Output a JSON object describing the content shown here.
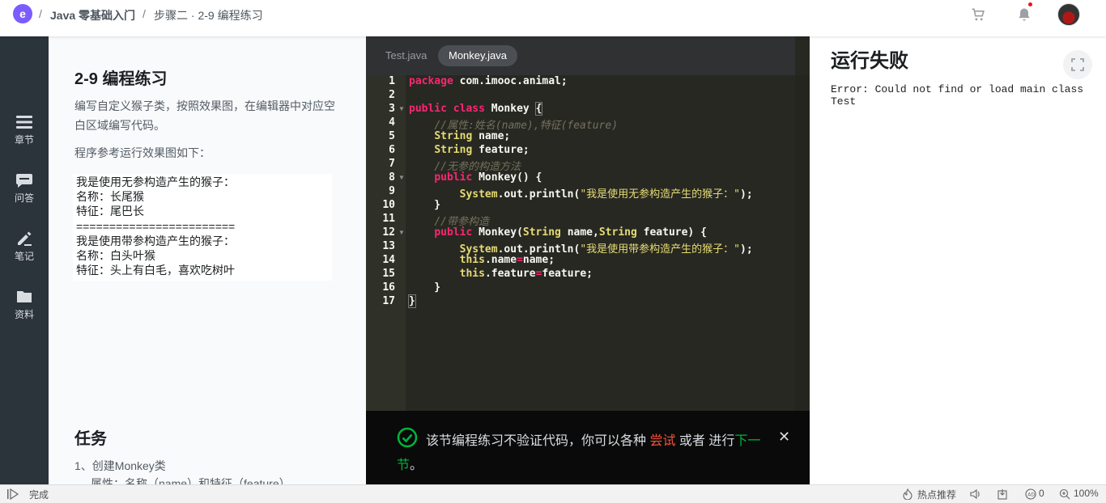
{
  "topbar": {
    "logo_glyph": "e",
    "sep1": "/",
    "course": "Java 零基础入门",
    "sep2": "/",
    "lesson": "步骤二 · 2-9 编程练习"
  },
  "leftnav": {
    "items": [
      {
        "label": "章节",
        "icon": "list-icon"
      },
      {
        "label": "问答",
        "icon": "chat-icon"
      },
      {
        "label": "笔记",
        "icon": "pencil-icon"
      },
      {
        "label": "资料",
        "icon": "folder-icon"
      }
    ]
  },
  "description": {
    "title": "2-9 编程练习",
    "intro": "编写自定义猴子类，按照效果图，在编辑器中对应空白区域编写代码。",
    "sample_caption": "程序参考运行效果图如下：",
    "sample_lines": [
      "我是使用无参构造产生的猴子：",
      "名称：长尾猴",
      "特征：尾巴长",
      "========================",
      "我是使用带参构造产生的猴子：",
      "名称：白头叶猴",
      "特征：头上有白毛，喜欢吃树叶"
    ],
    "task_title": "任务",
    "task_1": "1、创建Monkey类",
    "task_2": "属性：名称（name）和特征（feature）"
  },
  "editor": {
    "tabs": [
      "Test.java",
      "Monkey.java"
    ],
    "active_tab": "Monkey.java",
    "line_numbers": [
      "1",
      "2",
      "3",
      "4",
      "5",
      "6",
      "7",
      "8",
      "9",
      "10",
      "11",
      "12",
      "13",
      "14",
      "15",
      "16",
      "17"
    ]
  },
  "notice": {
    "text_before": "该节编程练习不验证代码，你可以各种 ",
    "try_link": "尝试",
    "text_middle": " 或者 进行",
    "next_part1": "下一",
    "next_part2": "节",
    "period": "。",
    "close": "✕"
  },
  "result": {
    "title": "运行失败",
    "error": "Error: Could not find or load main class Test"
  },
  "statusbar": {
    "status": "完成",
    "hot": "热点推荐",
    "zero": "0",
    "zoom": "100%"
  },
  "colors": {
    "accent_try": "#f2533b",
    "accent_next": "#00b43c",
    "nav_bg": "#2b333b",
    "editor_bg": "#272822"
  }
}
